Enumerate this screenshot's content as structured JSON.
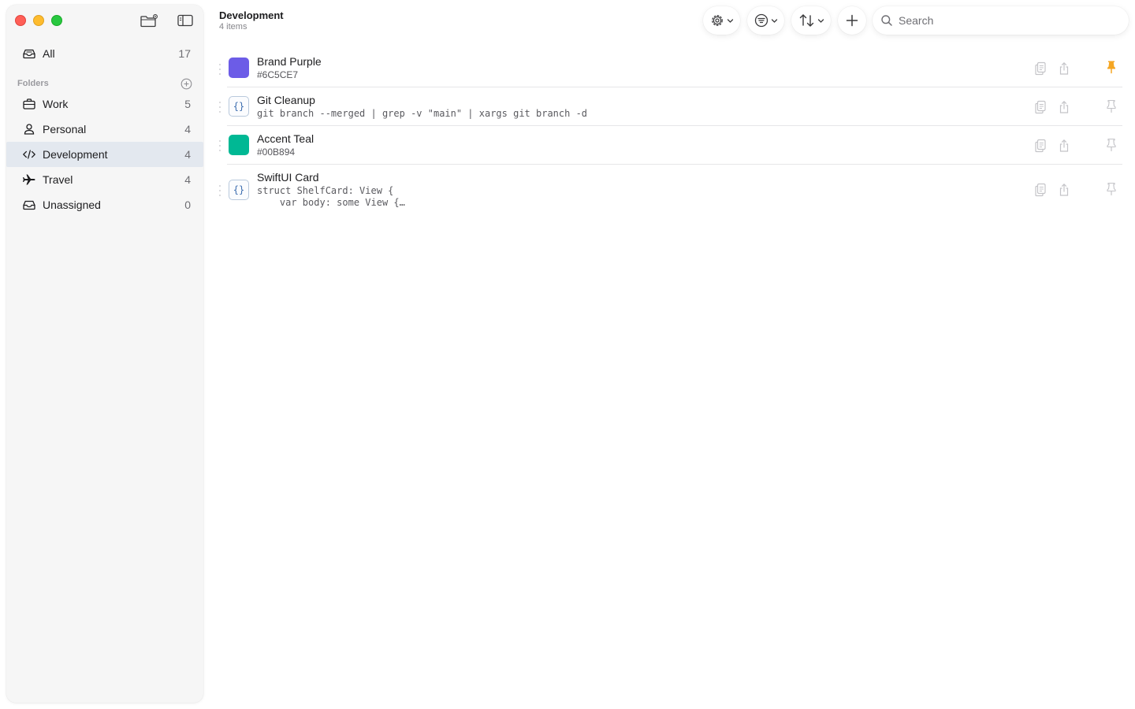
{
  "window": {
    "traffic_colors": {
      "close": "#ff5f57",
      "minimize": "#febc2e",
      "zoom": "#28c840"
    }
  },
  "sidebar": {
    "all": {
      "label": "All",
      "count": "17",
      "icon": "tray-icon"
    },
    "folders_heading": "Folders",
    "folders": [
      {
        "label": "Work",
        "count": "5",
        "icon": "briefcase-icon"
      },
      {
        "label": "Personal",
        "count": "4",
        "icon": "person-icon"
      },
      {
        "label": "Development",
        "count": "4",
        "icon": "code-icon",
        "selected": true
      },
      {
        "label": "Travel",
        "count": "4",
        "icon": "airplane-icon"
      },
      {
        "label": "Unassigned",
        "count": "0",
        "icon": "tray-icon"
      }
    ]
  },
  "header": {
    "title": "Development",
    "subtitle": "4 items"
  },
  "toolbar": {
    "settings_icon": "gear-icon",
    "filter_icon": "filter-icon",
    "sort_icon": "sort-icon",
    "add_icon": "plus-icon"
  },
  "search": {
    "placeholder": "Search",
    "value": ""
  },
  "items": [
    {
      "name": "Brand Purple",
      "detail": "#6C5CE7",
      "kind": "color",
      "swatch": "#6C5CE7",
      "pinned": true
    },
    {
      "name": "Git Cleanup",
      "detail": "git branch --merged | grep -v \"main\" | xargs git branch -d",
      "kind": "code",
      "pinned": false
    },
    {
      "name": "Accent Teal",
      "detail": "#00B894",
      "kind": "color",
      "swatch": "#00B894",
      "pinned": false
    },
    {
      "name": "SwiftUI Card",
      "detail": "struct ShelfCard: View {\n    var body: some View {…",
      "kind": "code",
      "pinned": false
    }
  ],
  "colors": {
    "accent_pin": "#f5a623",
    "selection": "#e3e8ef"
  }
}
